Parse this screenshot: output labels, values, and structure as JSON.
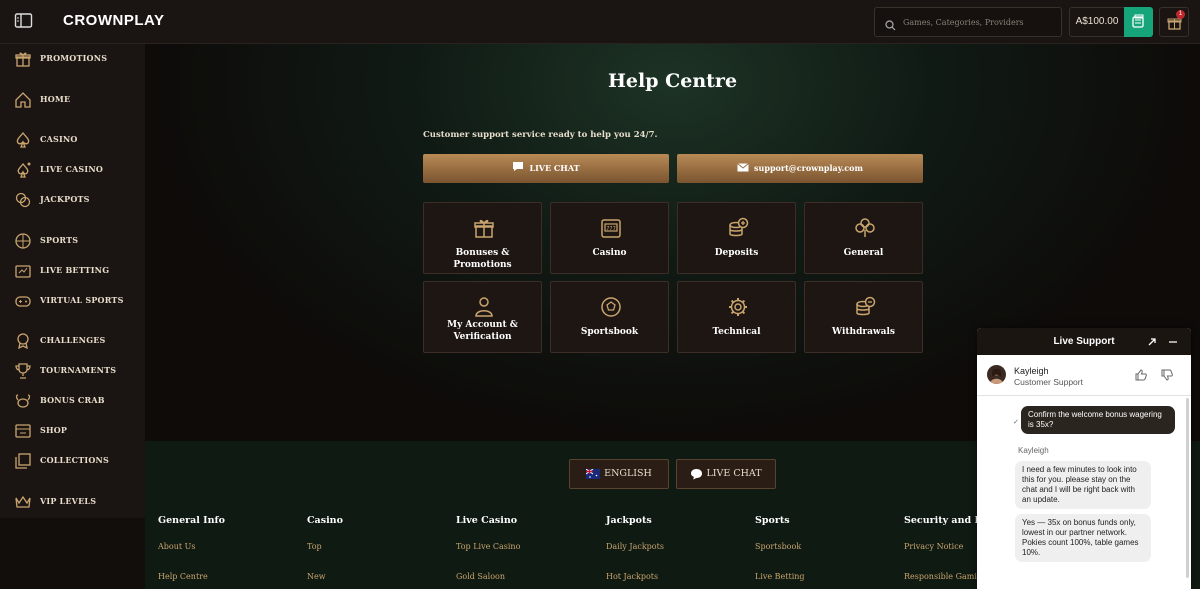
{
  "header": {
    "logo": "CROWNPLAY",
    "search_placeholder": "Games, Categories, Providers",
    "balance": "A$100.00",
    "notification_count": "1"
  },
  "sidebar": {
    "items": [
      {
        "label": "PROMOTIONS",
        "icon": "gift-icon"
      },
      {
        "label": "HOME",
        "icon": "home-icon"
      },
      {
        "label": "CASINO",
        "icon": "spade-icon"
      },
      {
        "label": "LIVE CASINO",
        "icon": "live-spade-icon"
      },
      {
        "label": "JACKPOTS",
        "icon": "coins-icon"
      },
      {
        "label": "SPORTS",
        "icon": "ball-icon"
      },
      {
        "label": "LIVE BETTING",
        "icon": "live-betting-icon"
      },
      {
        "label": "VIRTUAL SPORTS",
        "icon": "controller-icon"
      },
      {
        "label": "CHALLENGES",
        "icon": "medal-icon"
      },
      {
        "label": "TOURNAMENTS",
        "icon": "trophy-icon"
      },
      {
        "label": "BONUS CRAB",
        "icon": "crab-icon"
      },
      {
        "label": "SHOP",
        "icon": "shop-icon"
      },
      {
        "label": "COLLECTIONS",
        "icon": "collections-icon"
      },
      {
        "label": "VIP LEVELS",
        "icon": "crown-icon"
      }
    ]
  },
  "main": {
    "title": "Help Centre",
    "subtitle": "Customer support service ready to help you 24/7.",
    "live_chat": "LIVE CHAT",
    "email": "support@crownplay.com",
    "cards": [
      {
        "label": "Bonuses & Promotions",
        "icon": "gift-icon"
      },
      {
        "label": "Casino",
        "icon": "slot-machine-icon"
      },
      {
        "label": "Deposits",
        "icon": "coin-stack-plus-icon"
      },
      {
        "label": "General",
        "icon": "clover-icon"
      },
      {
        "label": "My Account & Verification",
        "icon": "user-icon"
      },
      {
        "label": "Sportsbook",
        "icon": "football-icon"
      },
      {
        "label": "Technical",
        "icon": "cog-icon"
      },
      {
        "label": "Withdrawals",
        "icon": "coin-stack-minus-icon"
      }
    ]
  },
  "footer": {
    "language": "ENGLISH",
    "live_chat": "LIVE CHAT",
    "columns": [
      {
        "heading": "General Info",
        "links": [
          "About Us",
          "Help Centre"
        ]
      },
      {
        "heading": "Casino",
        "links": [
          "Top",
          "New"
        ]
      },
      {
        "heading": "Live Casino",
        "links": [
          "Top Live Casino",
          "Gold Saloon"
        ]
      },
      {
        "heading": "Jackpots",
        "links": [
          "Daily Jackpots",
          "Hot Jackpots"
        ]
      },
      {
        "heading": "Sports",
        "links": [
          "Sportsbook",
          "Live Betting"
        ]
      },
      {
        "heading": "Security and Privacy",
        "links": [
          "Privacy Notice",
          "Responsible Gaming"
        ]
      }
    ]
  },
  "chat": {
    "title": "Live Support",
    "agent_name": "Kayleigh",
    "agent_role": "Customer Support",
    "user_message": "Confirm the welcome bonus wagering is 35x?",
    "sender": "Kayleigh",
    "agent_messages": [
      "I need a few minutes to look into this for you. please stay on the chat and I will be right back with an update.",
      "Yes — 35x on bonus funds only, lowest in our partner network. Pokies count 100%, table games 10%."
    ]
  },
  "colors": {
    "accent_gold": "#c9a46e",
    "wallet_green": "#16a57a",
    "badge_red": "#c0272d"
  }
}
